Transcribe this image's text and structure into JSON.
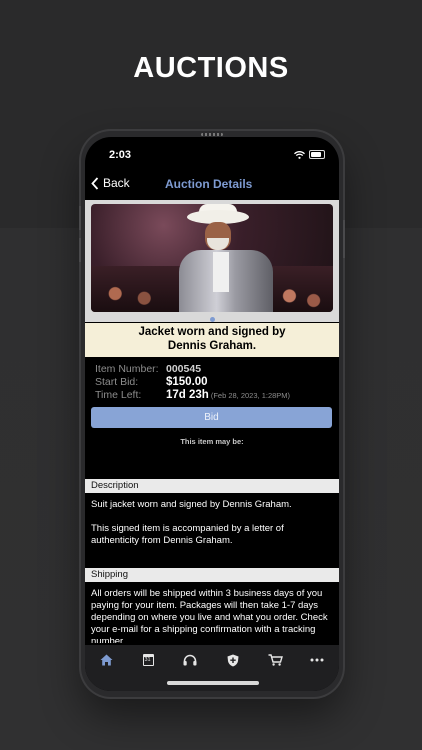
{
  "promo": {
    "headline": "AUCTIONS"
  },
  "status_bar": {
    "time": "2:03"
  },
  "nav": {
    "back_label": "Back",
    "title": "Auction Details"
  },
  "item": {
    "title_line1": "Jacket worn and signed by",
    "title_line2": "Dennis Graham.",
    "fields": [
      {
        "label": "Item Number:",
        "value": "000545"
      },
      {
        "label": "Start Bid:",
        "value": "$150.00"
      },
      {
        "label": "Time Left:",
        "value": "17d 23h",
        "extra": "(Feb 28, 2023, 1:28PM)"
      }
    ],
    "bid_label": "Bid",
    "may_be_text": "This item may be:"
  },
  "description": {
    "header": "Description",
    "line1": "Suit jacket worn and signed by Dennis Graham.",
    "line2": "This signed item is accompanied by a letter of authenticity from Dennis Graham."
  },
  "shipping": {
    "header": "Shipping",
    "text": "All orders will be shipped within 3 business days of you paying for your item. Packages will then take 1-7 days depending on where you live and what you order. Check your e-mail for a shipping confirmation with a tracking number."
  },
  "tabbar": {
    "calendar_day": "31",
    "icons": [
      "home-icon",
      "calendar-icon",
      "headphones-icon",
      "shield-icon",
      "cart-icon",
      "more-icon"
    ]
  },
  "colors": {
    "accent": "#7e9bd1",
    "bid_button": "#88a4d6",
    "title_bg": "#f5efd8",
    "section_header_bg": "#eaeaea"
  }
}
